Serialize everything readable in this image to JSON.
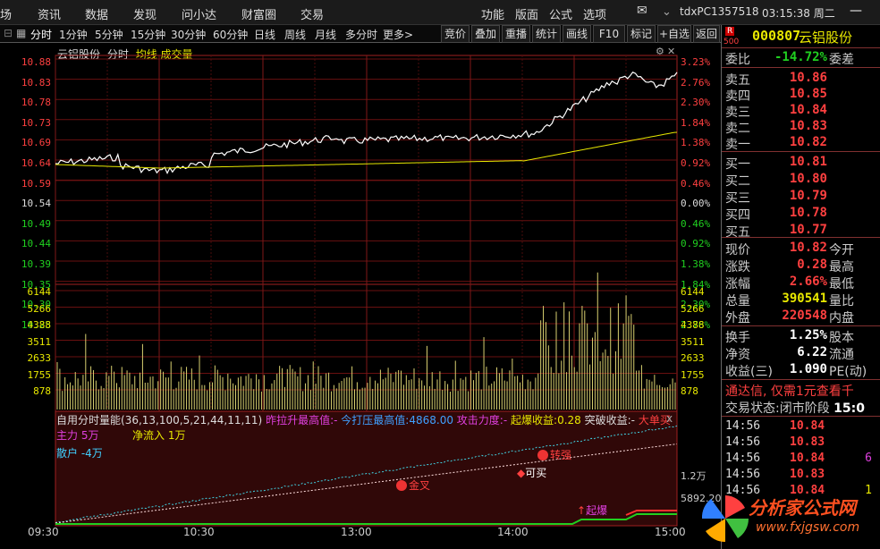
{
  "menu": {
    "items": [
      "场",
      "资讯",
      "数据",
      "发现",
      "问小达",
      "财富圈",
      "交易"
    ],
    "right_items": [
      "功能",
      "版面",
      "公式",
      "选项"
    ],
    "account": "tdxPC1357518",
    "time": "03:15:38 周二"
  },
  "periods": [
    "分时",
    "1分钟",
    "5分钟",
    "15分钟",
    "30分钟",
    "60分钟",
    "日线",
    "周线",
    "月线",
    "多分时",
    "更多>"
  ],
  "tools": [
    "竞价",
    "叠加",
    "重播",
    "统计",
    "画线",
    "F10",
    "标记",
    "+自选",
    "返回"
  ],
  "chart_header": {
    "name": "云铝股份",
    "mode": "分时",
    "avg": "均线",
    "vol": "成交量"
  },
  "price_axis": {
    "left": [
      "10.88",
      "10.83",
      "10.78",
      "10.73",
      "10.69",
      "10.64",
      "10.59",
      "10.54",
      "10.49",
      "10.44",
      "10.39",
      "10.35",
      "10.30",
      "10.25"
    ],
    "right": [
      "3.23%",
      "2.76%",
      "2.30%",
      "1.84%",
      "1.38%",
      "0.92%",
      "0.46%",
      "0.00%",
      "0.46%",
      "0.92%",
      "1.38%",
      "1.84%",
      "2.30%",
      "2.76%"
    ]
  },
  "vol_axis": [
    "6144",
    "5266",
    "4388",
    "3511",
    "2633",
    "1755",
    "878"
  ],
  "indicator": {
    "name": "自用分时量能",
    "params": "(36,13,100,5,21,44,11,11)",
    "t1": "昨拉升最高值:",
    "t2": "-",
    "t3": "今打压最高值:",
    "t4": "4868.00",
    "t5": "攻击力度:",
    "t6": "-",
    "t7": "起爆收益:",
    "t8": "0.28",
    "t9": "突破收益:",
    "t10": "-",
    "t11": "大单买",
    "close": "x",
    "zhuli": "主力 5万",
    "jingliuru": "净流入 1万",
    "sanhu": "散户 -4万",
    "ax1": "1.2万",
    "ax2": "5892.20"
  },
  "signals": {
    "s1": "转强",
    "s2": "可买",
    "s3": "金叉",
    "s4": "起爆"
  },
  "time_axis": [
    "09:30",
    "10:30",
    "13:00",
    "14:00",
    "15:00"
  ],
  "stock": {
    "code": "000807",
    "name": "云铝股份",
    "r": "R",
    "r_num": "500"
  },
  "weibi": {
    "label": "委比",
    "value": "-14.72%",
    "label2": "委差"
  },
  "asks": [
    {
      "k": "卖五",
      "v": "10.86"
    },
    {
      "k": "卖四",
      "v": "10.85"
    },
    {
      "k": "卖三",
      "v": "10.84"
    },
    {
      "k": "卖二",
      "v": "10.83"
    },
    {
      "k": "卖一",
      "v": "10.82"
    }
  ],
  "bids": [
    {
      "k": "买一",
      "v": "10.81"
    },
    {
      "k": "买二",
      "v": "10.80"
    },
    {
      "k": "买三",
      "v": "10.79"
    },
    {
      "k": "买四",
      "v": "10.78"
    },
    {
      "k": "买五",
      "v": "10.77"
    }
  ],
  "quote": [
    {
      "k": "现价",
      "v": "10.82",
      "k2": "今开",
      "c": "#ff4040"
    },
    {
      "k": "涨跌",
      "v": "0.28",
      "k2": "最高",
      "c": "#ff4040"
    },
    {
      "k": "涨幅",
      "v": "2.66%",
      "k2": "最低",
      "c": "#ff4040"
    },
    {
      "k": "总量",
      "v": "390541",
      "k2": "量比",
      "c": "#e8e800"
    },
    {
      "k": "外盘",
      "v": "220548",
      "k2": "内盘",
      "c": "#ff4040"
    }
  ],
  "quote2": [
    {
      "k": "换手",
      "v": "1.25%",
      "k2": "股本"
    },
    {
      "k": "净资",
      "v": "6.22",
      "k2": "流通"
    },
    {
      "k": "收益(三)",
      "v": "1.090",
      "k2": "PE(动)"
    }
  ],
  "ad": "通达信, 仅需1元查看千",
  "status": {
    "label": "交易状态:",
    "value": "闭市阶段",
    "time": "15:0"
  },
  "trades": [
    {
      "t": "14:56",
      "p": "10.84",
      "q": ""
    },
    {
      "t": "14:56",
      "p": "10.83",
      "q": ""
    },
    {
      "t": "14:56",
      "p": "10.84",
      "q": "6"
    },
    {
      "t": "14:56",
      "p": "10.83",
      "q": ""
    },
    {
      "t": "14:56",
      "p": "10.84",
      "q": "1"
    }
  ],
  "logo": {
    "text": "分析家公式网",
    "url": "www.fxjgsw.com"
  }
}
